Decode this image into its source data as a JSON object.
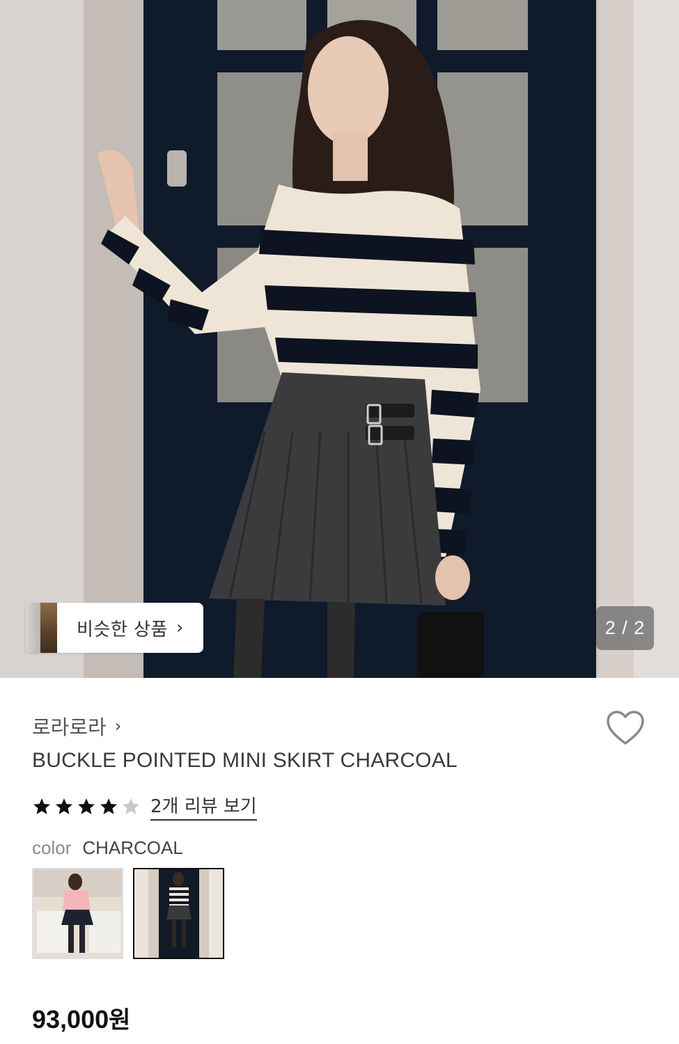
{
  "hero": {
    "image_icon": "product-photo",
    "similar_label": "비슷한 상품",
    "similar_chevron": "›",
    "pager_text": "2 / 2"
  },
  "product": {
    "brand": "로라로라",
    "brand_chevron": "›",
    "title": "BUCKLE POINTED MINI SKIRT CHARCOAL",
    "rating": 4,
    "rating_max": 5,
    "review_link": "2개 리뷰 보기",
    "color_label": "color",
    "color_value": "CHARCOAL",
    "price_number": "93,000",
    "price_unit": "원"
  },
  "swatches": [
    {
      "name": "pink-option-thumbnail",
      "selected": false
    },
    {
      "name": "charcoal-option-thumbnail",
      "selected": true
    }
  ],
  "colors": {
    "star_filled": "#111111",
    "star_empty": "#c8c8c8",
    "pager_bg": "#787878",
    "text_primary": "#222222"
  }
}
